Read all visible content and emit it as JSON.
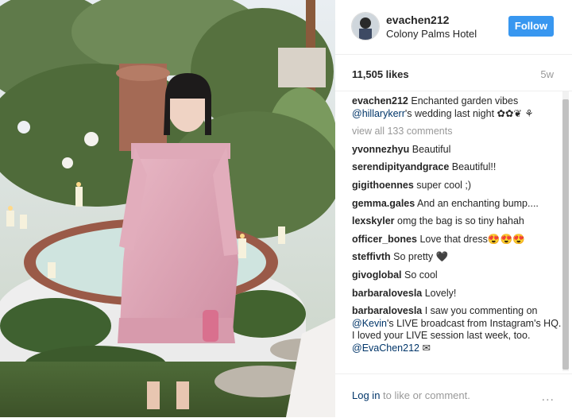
{
  "post": {
    "username": "evachen212",
    "location": "Colony Palms Hotel",
    "follow_label": "Follow",
    "likes": "11,505 likes",
    "age": "5w"
  },
  "caption": {
    "username": "evachen212",
    "text_before": "Enchanted garden vibes ",
    "mention": "@hillarykerr",
    "text_after": "'s wedding last night ✿✿❦ ⚘"
  },
  "view_all_comments": "view all 133 comments",
  "comments": [
    {
      "user": "yvonnezhyu",
      "text": "Beautiful"
    },
    {
      "user": "serendipityandgrace",
      "text": "Beautiful!!"
    },
    {
      "user": "gigithoennes",
      "text": "super cool ;)"
    },
    {
      "user": "gemma.gales",
      "text": "And an enchanting bump...."
    },
    {
      "user": "lexskyler",
      "text": "omg the bag is so tiny hahah"
    },
    {
      "user": "officer_bones",
      "text": "Love that dress😍😍😍"
    },
    {
      "user": "steffivth",
      "text": "So pretty 🖤"
    },
    {
      "user": "givoglobal",
      "text": "So cool"
    },
    {
      "user": "barbaralovesla",
      "text": "Lovely!"
    }
  ],
  "last_comment": {
    "user": "barbaralovesla",
    "text1": "I saw you commenting on ",
    "mention1": "@Kevin",
    "text2": "'s LIVE broadcast from Instagram's HQ. I loved your LIVE session last week, too. ",
    "mention2": "@EvaChen212",
    "text3": " ✉"
  },
  "footer": {
    "login_link": "Log in",
    "login_text": " to like or comment.",
    "more_icon": "..."
  },
  "colors": {
    "follow_button": "#3897f0",
    "link": "#003569",
    "muted": "#999999"
  },
  "icons": {
    "more": "ellipsis-icon",
    "avatar": "profile-avatar"
  }
}
